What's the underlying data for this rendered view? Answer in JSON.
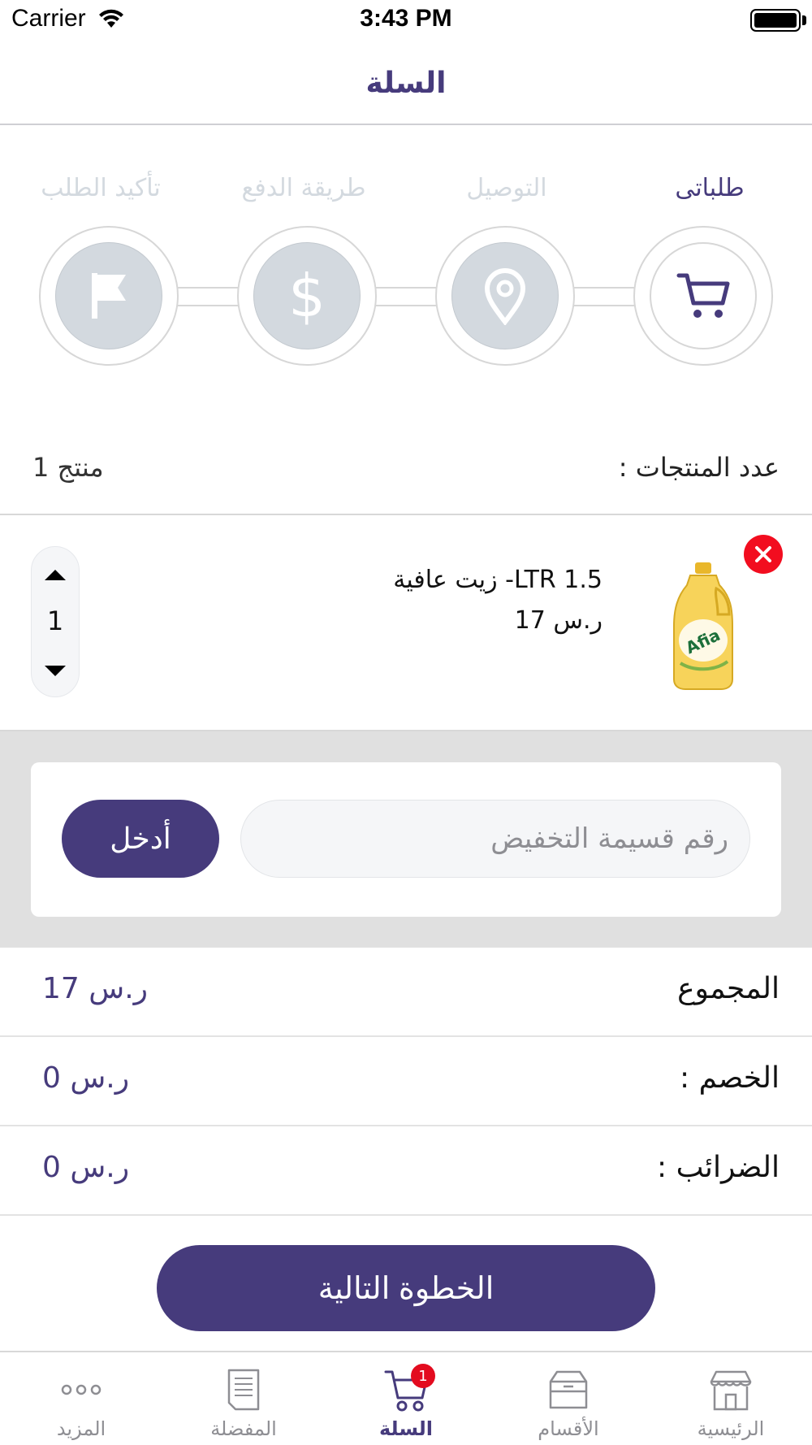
{
  "status_bar": {
    "carrier": "Carrier",
    "time": "3:43 PM"
  },
  "nav": {
    "title": "السلة"
  },
  "steps": [
    {
      "label": "طلباتى",
      "icon": "cart-icon",
      "active": true
    },
    {
      "label": "التوصيل",
      "icon": "location-pin-icon",
      "active": false
    },
    {
      "label": "طريقة الدفع",
      "icon": "dollar-icon",
      "active": false
    },
    {
      "label": "تأكيد الطلب",
      "icon": "flag-icon",
      "active": false
    }
  ],
  "product_count": {
    "label": "عدد المنتجات :",
    "value": "1  منتج"
  },
  "cart_item": {
    "name": "زيت عافية -LTR 1.5",
    "price": "17 ر.س",
    "quantity": "1",
    "image_icon": "oil-bottle-icon"
  },
  "coupon": {
    "placeholder": "رقم قسيمة التخفيض",
    "button_label": "أدخل"
  },
  "summary": {
    "total_label": "المجموع",
    "total_value": "17 ر.س",
    "discount_label": "الخصم :",
    "discount_value": "0 ر.س",
    "tax_label": "الضرائب :",
    "tax_value": "0 ر.س"
  },
  "next_button": "الخطوة التالية",
  "tabbar": [
    {
      "label": "المزيد",
      "icon": "more-icon",
      "active": false
    },
    {
      "label": "المفضلة",
      "icon": "document-icon",
      "active": false
    },
    {
      "label": "السلة",
      "icon": "cart-icon",
      "active": true,
      "badge": "1"
    },
    {
      "label": "الأقسام",
      "icon": "box-icon",
      "active": false
    },
    {
      "label": "الرئيسية",
      "icon": "store-icon",
      "active": false
    }
  ],
  "colors": {
    "primary": "#463b7c",
    "inactive_step": "#d3d9df",
    "remove": "#f20d1f",
    "background_gray": "#e0e0e0"
  }
}
